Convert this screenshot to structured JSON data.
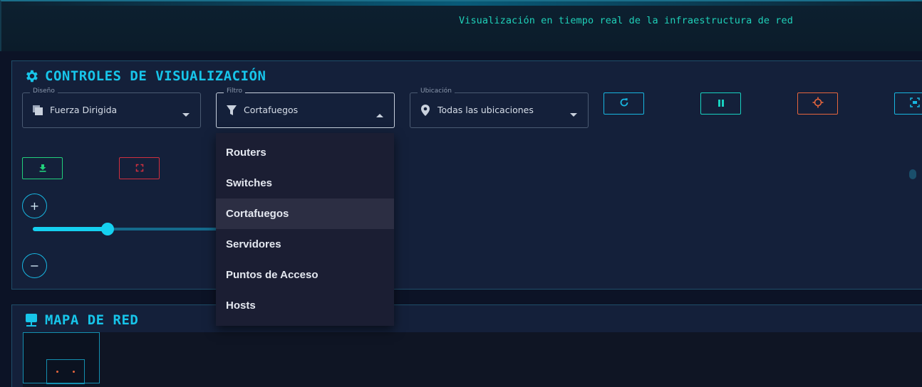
{
  "header": {
    "subtitle": "Visualización en tiempo real de la infraestructura de red"
  },
  "controls": {
    "title": "CONTROLES DE VISUALIZACIÓN",
    "layout": {
      "label": "Diseño",
      "value": "Fuerza Dirigida",
      "icon": "layers-icon"
    },
    "filter": {
      "label": "Filtro",
      "value": "Cortafuegos",
      "icon": "filter-icon",
      "open": true
    },
    "location": {
      "label": "Ubicación",
      "value": "Todas las ubicaciones",
      "icon": "location-pin-icon"
    },
    "buttons": [
      {
        "name": "refresh",
        "icon": "refresh-icon",
        "color": "#18b6e0"
      },
      {
        "name": "pause",
        "icon": "pause-icon",
        "color": "#18d2c0"
      },
      {
        "name": "center",
        "icon": "crosshair-icon",
        "color": "#e5653d"
      },
      {
        "name": "fit",
        "icon": "fit-screen-icon",
        "color": "#18b6e0"
      },
      {
        "name": "download",
        "icon": "download-icon",
        "color": "#22d07c"
      },
      {
        "name": "fullscreen",
        "icon": "fullscreen-icon",
        "color": "#d12f3f"
      }
    ],
    "zoom": {
      "in_label": "+",
      "out_label": "−",
      "level": 0.4
    }
  },
  "filter_menu": {
    "options": [
      "Routers",
      "Switches",
      "Cortafuegos",
      "Servidores",
      "Puntos de Acceso",
      "Hosts"
    ],
    "selected_index": 2
  },
  "map": {
    "title": "MAPA DE RED",
    "icon": "network-icon"
  },
  "colors": {
    "accent": "#17c5ea",
    "subtitle": "#1fd0b8",
    "panel_bg": "#14203a"
  }
}
